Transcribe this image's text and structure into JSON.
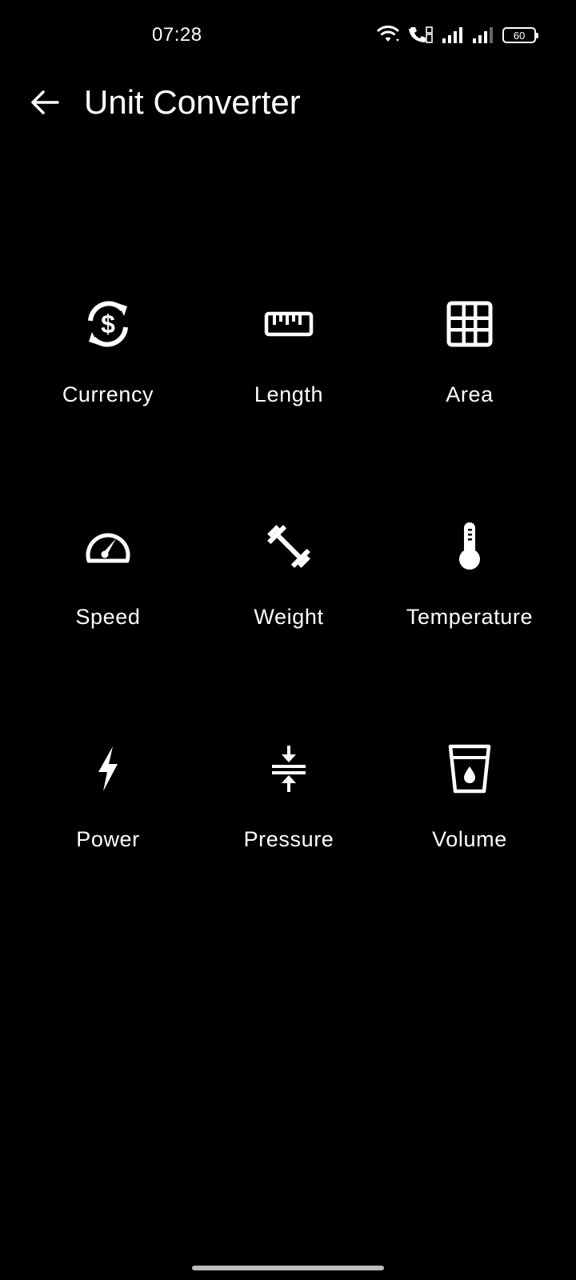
{
  "status_bar": {
    "time": "07:28",
    "battery_level": "60",
    "icons": [
      "wifi-icon",
      "wifi-calling-icon",
      "signal-icon",
      "signal-icon"
    ]
  },
  "app_bar": {
    "title": "Unit Converter",
    "back_icon": "arrow-back-icon"
  },
  "categories": [
    {
      "label": "Currency",
      "icon": "currency-exchange-icon"
    },
    {
      "label": "Length",
      "icon": "ruler-icon"
    },
    {
      "label": "Area",
      "icon": "grid-icon"
    },
    {
      "label": "Speed",
      "icon": "speedometer-icon"
    },
    {
      "label": "Weight",
      "icon": "dumbbell-icon"
    },
    {
      "label": "Temperature",
      "icon": "thermometer-icon"
    },
    {
      "label": "Power",
      "icon": "lightning-bolt-icon"
    },
    {
      "label": "Pressure",
      "icon": "compress-icon"
    },
    {
      "label": "Volume",
      "icon": "water-glass-icon"
    }
  ],
  "colors": {
    "background": "#000000",
    "foreground": "#ffffff",
    "home_indicator": "#bdbdbd"
  }
}
